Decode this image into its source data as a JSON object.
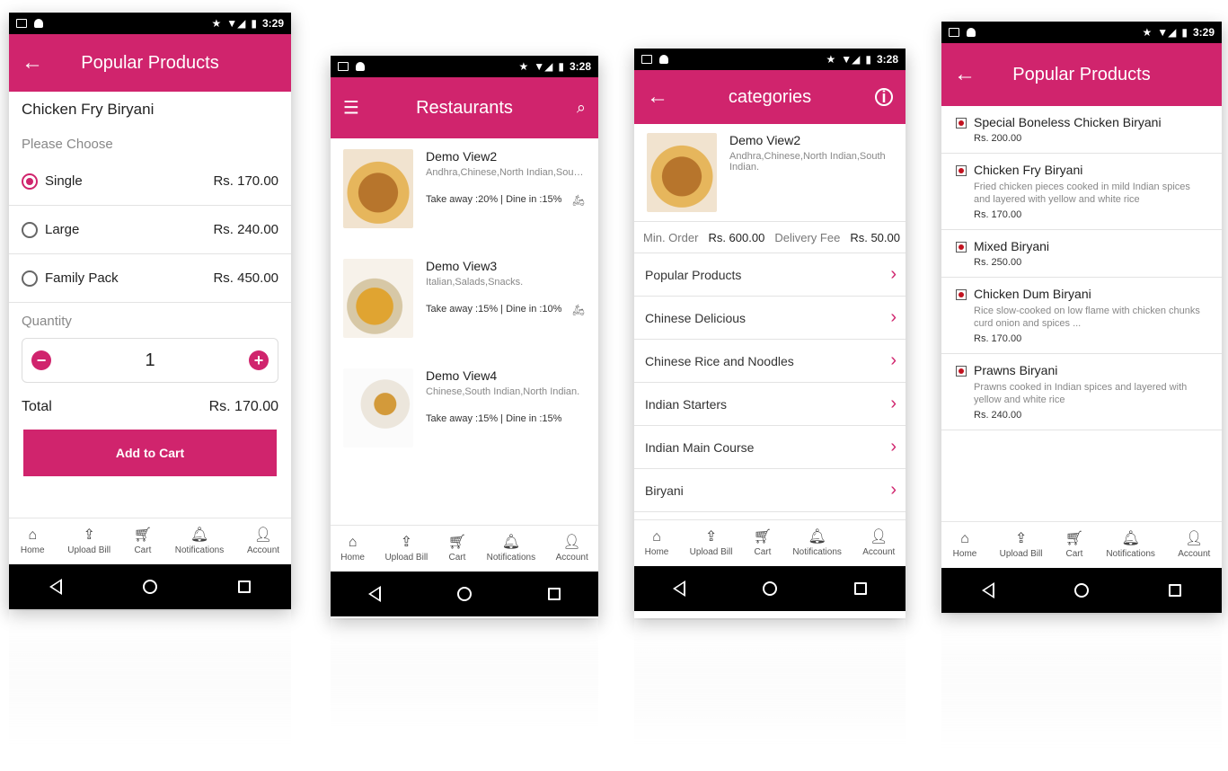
{
  "status": {
    "time_1": "3:29",
    "time_2": "3:28",
    "time_3": "3:28",
    "time_4": "3:29"
  },
  "bottom_nav": [
    "Home",
    "Upload Bill",
    "Cart",
    "Notifications",
    "Account"
  ],
  "screen1": {
    "title": "Popular Products",
    "product_name": "Chicken Fry Biryani",
    "choose_label": "Please Choose",
    "options": [
      {
        "label": "Single",
        "price": "Rs. 170.00",
        "selected": true
      },
      {
        "label": "Large",
        "price": "Rs. 240.00",
        "selected": false
      },
      {
        "label": "Family Pack",
        "price": "Rs. 450.00",
        "selected": false
      }
    ],
    "quantity_label": "Quantity",
    "quantity": "1",
    "total_label": "Total",
    "total_value": "Rs. 170.00",
    "add_to_cart": "Add to Cart"
  },
  "screen2": {
    "title": "Restaurants",
    "restaurants": [
      {
        "name": "Demo View2",
        "cuisine": "Andhra,Chinese,North Indian,South...",
        "offer": "Take away :20% | Dine in :15%"
      },
      {
        "name": "Demo View3",
        "cuisine": "Italian,Salads,Snacks.",
        "offer": "Take away :15% | Dine in :10%"
      },
      {
        "name": "Demo View4",
        "cuisine": "Chinese,South Indian,North Indian.",
        "offer": "Take away :15% | Dine in :15%"
      }
    ]
  },
  "screen3": {
    "title": "categories",
    "restaurant_name": "Demo View2",
    "cuisine": "Andhra,Chinese,North Indian,South Indian.",
    "min_order_label": "Min. Order",
    "min_order_value": "Rs. 600.00",
    "delivery_fee_label": "Delivery Fee",
    "delivery_fee_value": "Rs. 50.00",
    "categories": [
      "Popular Products",
      "Chinese Delicious",
      "Chinese Rice and Noodles",
      "Indian Starters",
      "Indian Main Course",
      "Biryani"
    ]
  },
  "screen4": {
    "title": "Popular Products",
    "products": [
      {
        "name": "Special Boneless Chicken Biryani",
        "desc": "",
        "price": "Rs. 200.00"
      },
      {
        "name": "Chicken Fry Biryani",
        "desc": "Fried chicken pieces cooked in mild Indian spices and layered with yellow and white rice",
        "price": "Rs. 170.00"
      },
      {
        "name": "Mixed Biryani",
        "desc": "",
        "price": "Rs. 250.00"
      },
      {
        "name": "Chicken Dum Biryani",
        "desc": "Rice slow-cooked on low flame with chicken chunks curd onion and spices ...",
        "price": "Rs. 170.00"
      },
      {
        "name": "Prawns Biryani",
        "desc": "Prawns cooked in Indian spices and layered with yellow and white rice",
        "price": "Rs. 240.00"
      }
    ]
  }
}
